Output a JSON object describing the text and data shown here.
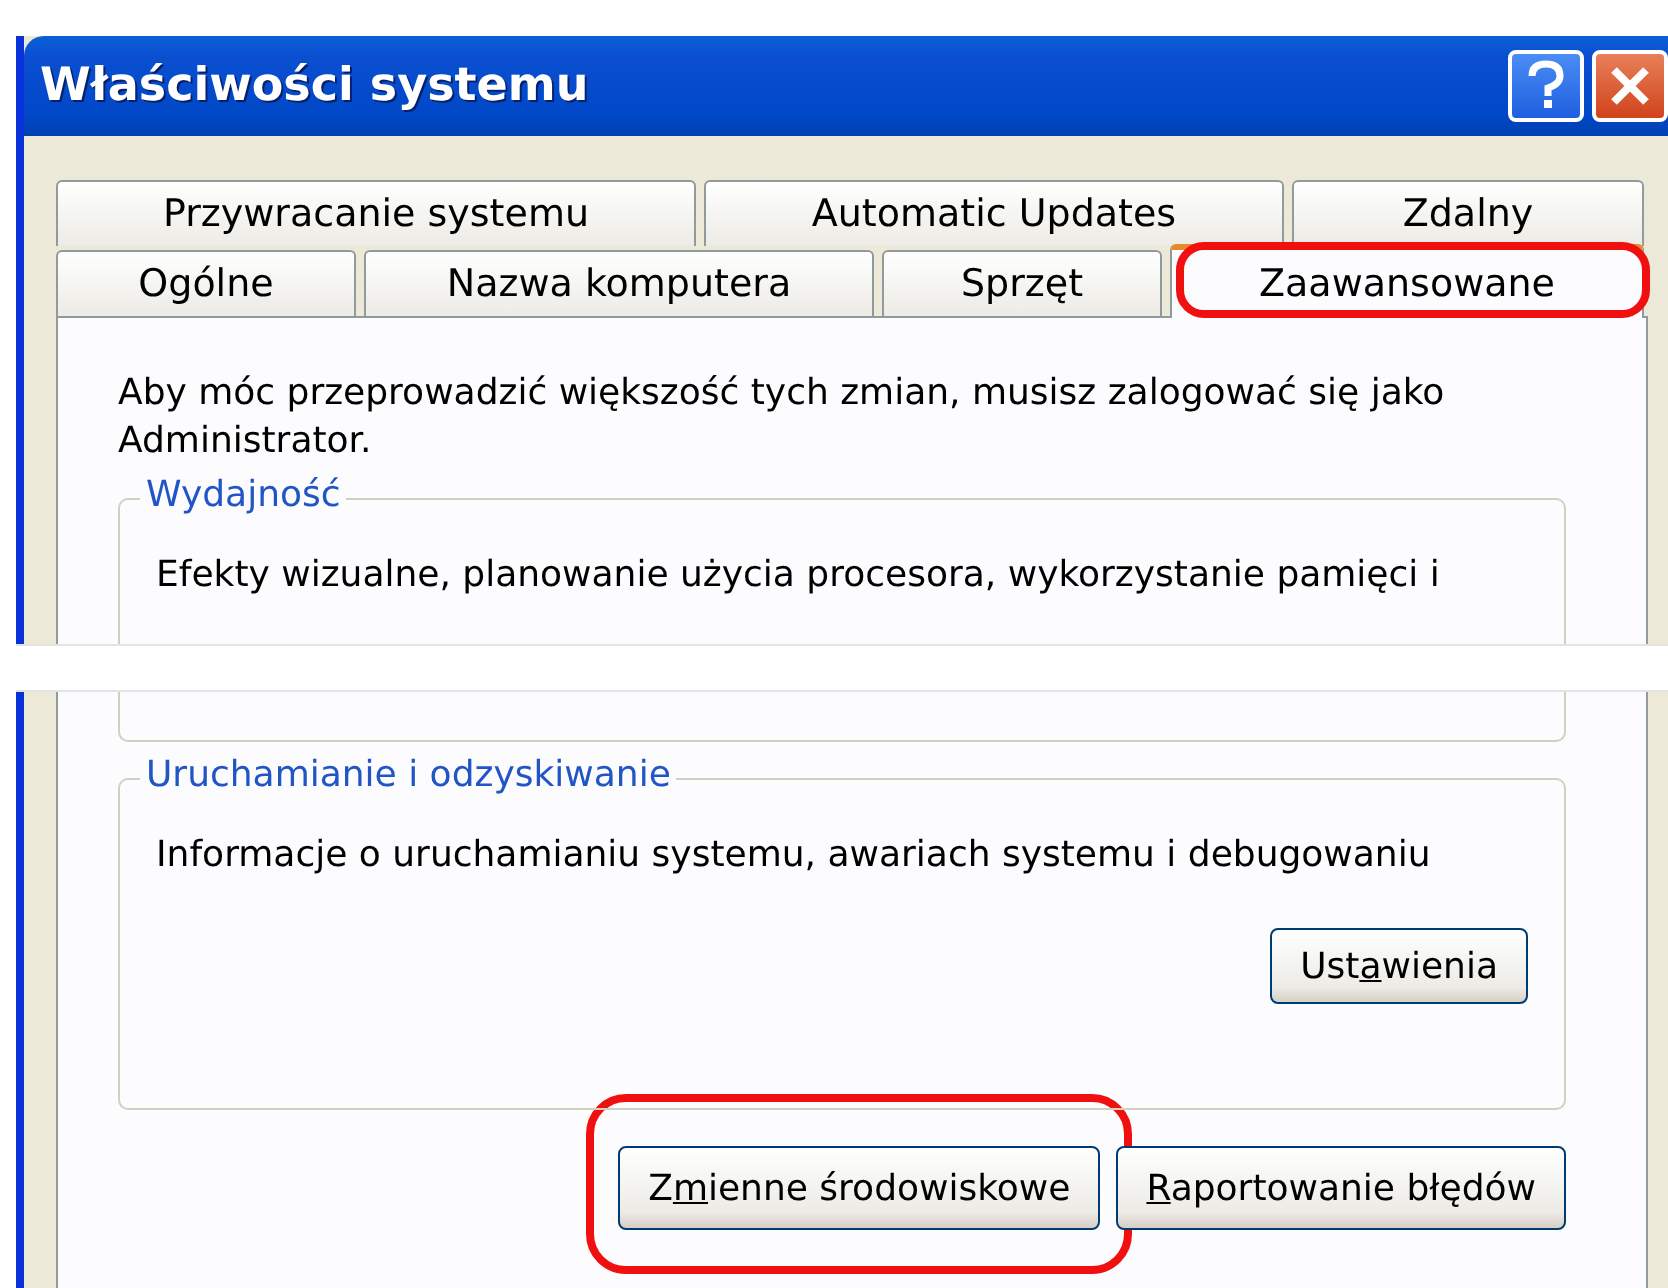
{
  "window": {
    "title": "Właściwości systemu"
  },
  "tab_rows": [
    [
      {
        "label": "Przywracanie systemu",
        "selected": false,
        "highlighted": false
      },
      {
        "label": "Automatic Updates",
        "selected": false,
        "highlighted": false
      },
      {
        "label": "Zdalny",
        "selected": false,
        "highlighted": false
      }
    ],
    [
      {
        "label": "Ogólne",
        "selected": false,
        "highlighted": false
      },
      {
        "label": "Nazwa komputera",
        "selected": false,
        "highlighted": false
      },
      {
        "label": "Sprzęt",
        "selected": false,
        "highlighted": false
      },
      {
        "label": "Zaawansowane",
        "selected": true,
        "highlighted": true
      }
    ]
  ],
  "notice": "Aby móc przeprowadzić większość tych zmian, musisz zalogować się jako Administrator.",
  "groups": [
    {
      "title": "Wydajność",
      "text": "Efekty wizualne, planowanie użycia procesora, wykorzystanie pamięci i"
    },
    {
      "title": "Uruchamianie i odzyskiwanie",
      "text": "Informacje o uruchamianiu systemu, awariach systemu i debugowaniu",
      "button": {
        "before": "Ust",
        "key": "a",
        "after": "wienia",
        "highlighted": false
      }
    }
  ],
  "buttons": [
    {
      "before": "Z",
      "key": "m",
      "after": "ienne środowiskowe",
      "highlighted": true
    },
    {
      "key": "R",
      "after": "aportowanie błędów",
      "highlighted": false
    }
  ]
}
